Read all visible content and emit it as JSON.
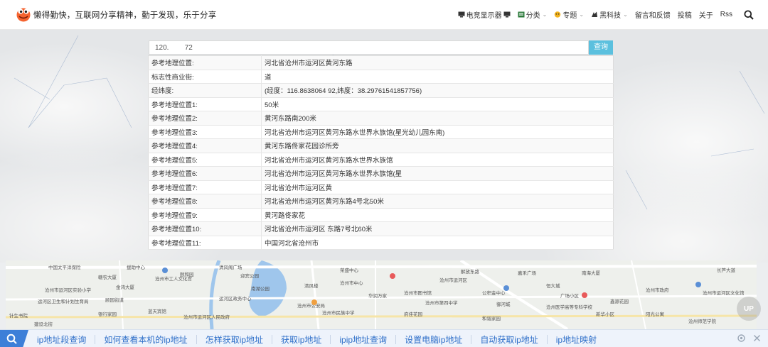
{
  "header": {
    "slogan": "懒得勤快，互联网分享精神，勤于发现，乐于分享",
    "nav": [
      {
        "label": "电竞显示器",
        "icon": "monitor-icon",
        "dropdown": false
      },
      {
        "label": "分类",
        "icon": "category-icon",
        "dropdown": true
      },
      {
        "label": "专题",
        "icon": "topic-icon",
        "dropdown": true
      },
      {
        "label": "黑科技",
        "icon": "tech-icon",
        "dropdown": true
      },
      {
        "label": "留言和反馈",
        "icon": "",
        "dropdown": false
      },
      {
        "label": "投稿",
        "icon": "",
        "dropdown": false
      },
      {
        "label": "关于",
        "icon": "",
        "dropdown": false
      },
      {
        "label": "Rss",
        "icon": "",
        "dropdown": false
      }
    ]
  },
  "query": {
    "value": "120.        72",
    "button_label": "查询"
  },
  "results": [
    {
      "key": "参考地理位置:",
      "value": "河北省沧州市运河区黄河东路"
    },
    {
      "key": "标志性商业街:",
      "value": "                  道"
    },
    {
      "key": "经纬度:",
      "value": "(经度：116.8638064         92,纬度：38.29761541857756)"
    },
    {
      "key": "参考地理位置1:",
      "value": "                50米"
    },
    {
      "key": "参考地理位置2:",
      "value": "黄河东路南200米"
    },
    {
      "key": "参考地理位置3:",
      "value": "河北省沧州市运河区黄河东路水世界水族馆(星光幼儿园东南)"
    },
    {
      "key": "参考地理位置4:",
      "value": "黄河东路佟家花园诊所旁"
    },
    {
      "key": "参考地理位置5:",
      "value": "河北省沧州市运河区黄河东路水世界水族馆"
    },
    {
      "key": "参考地理位置6:",
      "value": "河北省沧州市运河区黄河东路水世界水族馆(星"
    },
    {
      "key": "参考地理位置7:",
      "value": "河北省沧州市运河区黄"
    },
    {
      "key": "参考地理位置8:",
      "value": "河北省沧州市运河区黄河东路4号北50米"
    },
    {
      "key": "参考地理位置9:",
      "value": "黄河路佟家花"
    },
    {
      "key": "参考地理位置10:",
      "value": "河北省沧州市运河区        东路7号北60米"
    },
    {
      "key": "参考地理位置11:",
      "value": "中国河北省沧州市"
    }
  ],
  "map_labels": [
    "中国太平洋保险",
    "援助中心",
    "清风阁广场",
    "赣农大厦",
    "沧州市工人文化宫",
    "迎宾公园",
    "南湖公园",
    "金鸿大厦",
    "解放东路",
    "嘉禾广场",
    "颐和园",
    "清风楼",
    "沧州市运河区",
    "沧州市运河区实验小学",
    "运河区卫生和计划生育局",
    "针生书院",
    "顾园街道",
    "运河区政务中心",
    "银行家园",
    "蓝天宾馆",
    "沧州市中心",
    "沧州市运河区人民政府",
    "荣盛中心",
    "沧州市图书馆",
    "府佳花园",
    "沧州市公安局",
    "公积金中心",
    "沧州市第四中学",
    "恒大城",
    "南海大厦",
    "御河城",
    "沧州市民族中学",
    "和谐家园",
    "长芦大道",
    "华润万家",
    "沧州医学高等专科学校",
    "广场小区",
    "鑫源花园",
    "沧州市政府",
    "沧州市运河区文化馆",
    "新华小区",
    "阳光公寓",
    "建设北街",
    "沧州师范学院"
  ],
  "up_label": "UP",
  "bottom_links": [
    "ip地址段查询",
    "如何查看本机的ip地址",
    "怎样获取ip地址",
    "获取ip地址",
    "ipip地址查询",
    "设置电脑ip地址",
    "自动获取ip地址",
    "ip地址映射"
  ],
  "colors": {
    "query_button": "#5bc0de",
    "bottom_link": "#2e6fc9",
    "bottom_bar": "#eef3fb",
    "logo": "#f5632f"
  }
}
